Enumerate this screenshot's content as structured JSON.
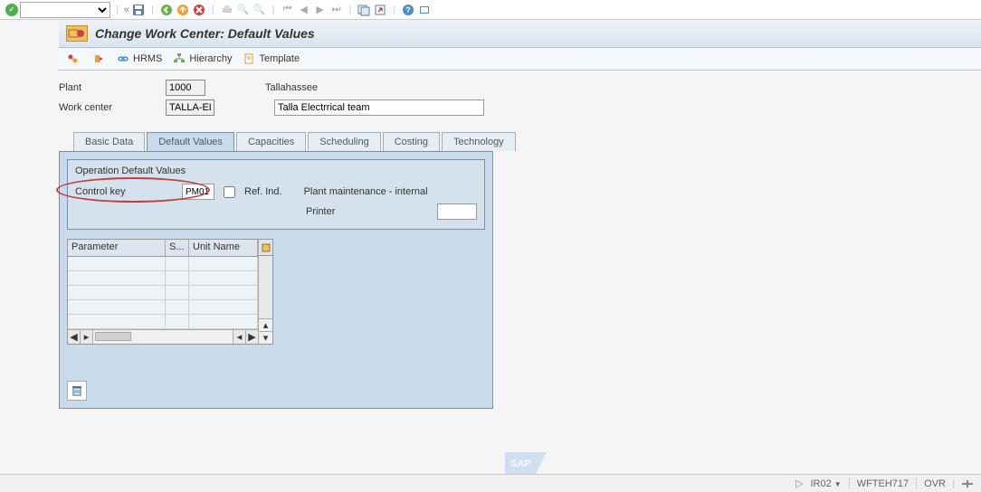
{
  "toolbar": {
    "combo_value": ""
  },
  "title": "Change Work Center: Default Values",
  "subtoolbar": {
    "hrms": "HRMS",
    "hierarchy": "Hierarchy",
    "template": "Template"
  },
  "header": {
    "plant_label": "Plant",
    "plant_value": "1000",
    "plant_desc": "Tallahassee",
    "workcenter_label": "Work center",
    "workcenter_value": "TALLA-EL",
    "workcenter_desc": "Talla Electrrical team"
  },
  "tabs": [
    "Basic Data",
    "Default Values",
    "Capacities",
    "Scheduling",
    "Costing",
    "Technology"
  ],
  "active_tab": 1,
  "group": {
    "title": "Operation Default Values",
    "control_key_label": "Control key",
    "control_key_value": "PM01",
    "ref_ind_label": "Ref.  Ind.",
    "desc": "Plant maintenance - internal",
    "printer_label": "Printer",
    "printer_value": ""
  },
  "table": {
    "columns": [
      "Parameter",
      "S...",
      "Unit Name"
    ]
  },
  "status": {
    "tcode": "IR02",
    "host": "WFTEH717",
    "mode": "OVR"
  }
}
